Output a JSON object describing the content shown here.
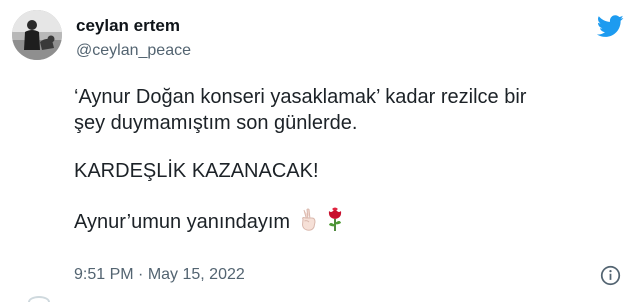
{
  "author": {
    "display_name": "ceylan ertem",
    "handle": "@ceylan_peace",
    "avatar_icon": "person-with-dog-photo"
  },
  "brand": {
    "icon": "twitter-bird-icon",
    "color": "#1d9bf0"
  },
  "tweet": {
    "paragraphs": [
      "‘Aynur Doğan konseri yasaklamak’ kadar rezilce bir\nşey duymamıştım son günlerde.",
      "KARDEŞLİK KAZANACAK!",
      "Aynur’umun yanındayım"
    ],
    "emojis": [
      "victory-hand-emoji",
      "rose-emoji"
    ]
  },
  "meta": {
    "time": "9:51 PM",
    "separator": " · ",
    "date": "May 15, 2022",
    "info_icon": "info-icon"
  },
  "colors": {
    "text": "#0f1419",
    "secondary": "#536471"
  }
}
